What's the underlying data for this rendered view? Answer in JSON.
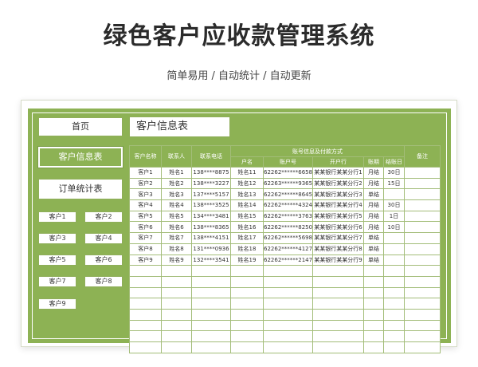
{
  "header": {
    "title": "绿色客户应收款管理系统",
    "subtitle": "简单易用 / 自动统计 / 自动更新"
  },
  "sidebar": {
    "home": "首页",
    "customer_info": "客户信息表",
    "order_stats": "订单统计表",
    "customers": [
      "客户1",
      "客户2",
      "客户3",
      "客户4",
      "客户5",
      "客户6",
      "客户7",
      "客户8",
      "客户9"
    ]
  },
  "sheet": {
    "title": "客户信息表",
    "group_header": "账号信息及付款方式",
    "columns": {
      "customer_name": "客户名称",
      "contact": "联系人",
      "phone": "联系电话",
      "account_name": "户名",
      "account_no": "账户号",
      "bank": "开户行",
      "terms": "账期",
      "settle_day": "结账日",
      "notes": "备注"
    },
    "rows": [
      [
        "客户1",
        "姓名1",
        "138****8875",
        "姓名11",
        "62262******6658",
        "某某银行某某分行1",
        "月结",
        "30日",
        ""
      ],
      [
        "客户2",
        "姓名2",
        "138****3227",
        "姓名12",
        "62263******9365",
        "某某银行某某分行2",
        "月结",
        "15日",
        ""
      ],
      [
        "客户3",
        "姓名3",
        "137****5157",
        "姓名13",
        "62262******8645",
        "某某银行某某分行3",
        "单结",
        "",
        ""
      ],
      [
        "客户4",
        "姓名4",
        "138****3525",
        "姓名14",
        "62262******4324",
        "某某银行某某分行4",
        "月结",
        "30日",
        ""
      ],
      [
        "客户5",
        "姓名5",
        "134****3481",
        "姓名15",
        "62262******3763",
        "某某银行某某分行5",
        "月结",
        "1日",
        ""
      ],
      [
        "客户6",
        "姓名6",
        "138****8365",
        "姓名16",
        "62262******8250",
        "某某银行某某分行6",
        "月结",
        "10日",
        ""
      ],
      [
        "客户7",
        "姓名7",
        "138****4151",
        "姓名17",
        "62262******5698",
        "某某银行某某分行7",
        "单结",
        "",
        ""
      ],
      [
        "客户8",
        "姓名8",
        "131****0936",
        "姓名18",
        "62262******4127",
        "某某银行某某分行8",
        "单结",
        "",
        ""
      ],
      [
        "客户9",
        "姓名9",
        "132****3541",
        "姓名19",
        "62262******2147",
        "某某银行某某分行9",
        "单结",
        "",
        ""
      ]
    ],
    "empty_rows": 8
  },
  "colors": {
    "accent": "#8db254",
    "grid_line": "#a3bd79"
  }
}
